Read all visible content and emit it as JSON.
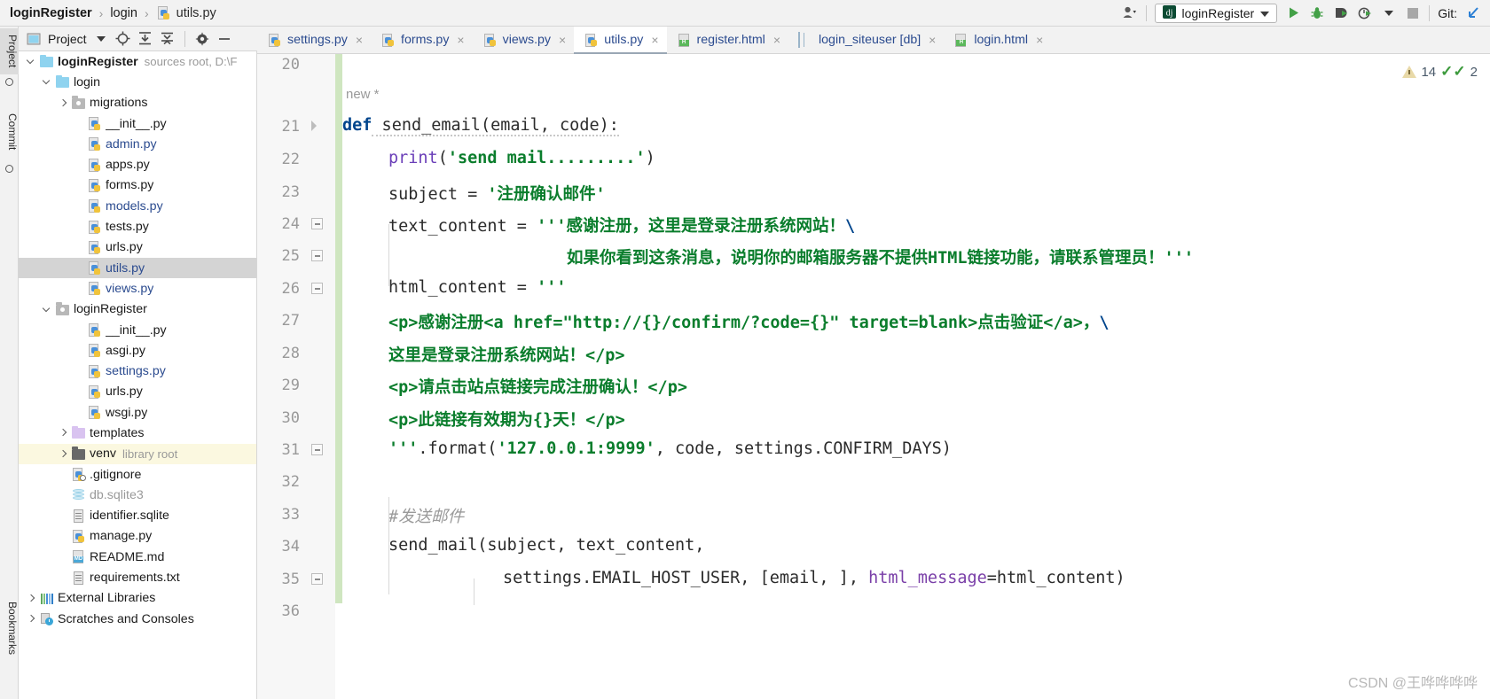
{
  "breadcrumb": {
    "items": [
      "loginRegister",
      "login",
      "utils.py"
    ],
    "separator": "›"
  },
  "topbar_right": {
    "account_icon": "user-account-icon",
    "run_config_name": "loginRegister",
    "run_config_icon": "django-icon",
    "dropdown_icon": "chevron-down-icon",
    "run_icon": "run-play-icon",
    "debug_icon": "debug-bug-icon",
    "coverage_icon": "run-coverage-icon",
    "profile_icon": "profiler-icon",
    "stop_icon": "stop-square-icon",
    "git_label": "Git:",
    "git_update_icon": "git-update-arrow-icon"
  },
  "left_strip": {
    "tabs": [
      "Project",
      "Commit",
      "Bookmarks"
    ]
  },
  "project_toolbar": {
    "title": "Project",
    "icons": [
      "project-view-icon",
      "chevron-down-icon",
      "locate-target-icon",
      "expand-all-icon",
      "collapse-all-icon",
      "settings-gear-icon",
      "hide-minus-icon"
    ]
  },
  "tree": {
    "items": [
      {
        "label": "loginRegister",
        "note": "sources root,  D:\\F",
        "icon": "folder-blue-icon",
        "indent": 0,
        "arrow": "open",
        "bold": true,
        "style": "plain"
      },
      {
        "label": "login",
        "note": "",
        "icon": "folder-blue-icon",
        "indent": 1,
        "arrow": "open",
        "bold": false,
        "style": "plain"
      },
      {
        "label": "migrations",
        "note": "",
        "icon": "folder-gray-icon",
        "indent": 2,
        "arrow": "closed",
        "bold": false,
        "style": "plain"
      },
      {
        "label": "__init__.py",
        "note": "",
        "icon": "python-file-icon",
        "indent": 3,
        "arrow": "none",
        "bold": false,
        "style": "plain"
      },
      {
        "label": "admin.py",
        "note": "",
        "icon": "python-file-icon",
        "indent": 3,
        "arrow": "none",
        "bold": false,
        "style": "blue"
      },
      {
        "label": "apps.py",
        "note": "",
        "icon": "python-file-icon",
        "indent": 3,
        "arrow": "none",
        "bold": false,
        "style": "plain"
      },
      {
        "label": "forms.py",
        "note": "",
        "icon": "python-file-icon",
        "indent": 3,
        "arrow": "none",
        "bold": false,
        "style": "plain"
      },
      {
        "label": "models.py",
        "note": "",
        "icon": "python-file-icon",
        "indent": 3,
        "arrow": "none",
        "bold": false,
        "style": "blue"
      },
      {
        "label": "tests.py",
        "note": "",
        "icon": "python-file-icon",
        "indent": 3,
        "arrow": "none",
        "bold": false,
        "style": "plain"
      },
      {
        "label": "urls.py",
        "note": "",
        "icon": "python-file-icon",
        "indent": 3,
        "arrow": "none",
        "bold": false,
        "style": "plain"
      },
      {
        "label": "utils.py",
        "note": "",
        "icon": "python-file-icon",
        "indent": 3,
        "arrow": "none",
        "bold": false,
        "style": "blue",
        "selected": true
      },
      {
        "label": "views.py",
        "note": "",
        "icon": "python-file-icon",
        "indent": 3,
        "arrow": "none",
        "bold": false,
        "style": "blue"
      },
      {
        "label": "loginRegister",
        "note": "",
        "icon": "folder-gray-icon",
        "indent": 1,
        "arrow": "open",
        "bold": false,
        "style": "plain"
      },
      {
        "label": "__init__.py",
        "note": "",
        "icon": "python-file-icon",
        "indent": 3,
        "arrow": "none",
        "bold": false,
        "style": "plain"
      },
      {
        "label": "asgi.py",
        "note": "",
        "icon": "python-file-icon",
        "indent": 3,
        "arrow": "none",
        "bold": false,
        "style": "plain"
      },
      {
        "label": "settings.py",
        "note": "",
        "icon": "python-file-icon",
        "indent": 3,
        "arrow": "none",
        "bold": false,
        "style": "blue"
      },
      {
        "label": "urls.py",
        "note": "",
        "icon": "python-file-icon",
        "indent": 3,
        "arrow": "none",
        "bold": false,
        "style": "plain"
      },
      {
        "label": "wsgi.py",
        "note": "",
        "icon": "python-file-icon",
        "indent": 3,
        "arrow": "none",
        "bold": false,
        "style": "plain"
      },
      {
        "label": "templates",
        "note": "",
        "icon": "folder-purple-icon",
        "indent": 2,
        "arrow": "closed",
        "bold": false,
        "style": "plain"
      },
      {
        "label": "venv",
        "note": "library root",
        "icon": "folder-dark-icon",
        "indent": 2,
        "arrow": "closed",
        "bold": false,
        "style": "plain",
        "highlight": true
      },
      {
        "label": ".gitignore",
        "note": "",
        "icon": "gitignore-file-icon",
        "indent": 2,
        "arrow": "none",
        "bold": false,
        "style": "plain"
      },
      {
        "label": "db.sqlite3",
        "note": "",
        "icon": "database-file-icon",
        "indent": 2,
        "arrow": "none",
        "bold": false,
        "style": "gray"
      },
      {
        "label": "identifier.sqlite",
        "note": "",
        "icon": "text-file-icon",
        "indent": 2,
        "arrow": "none",
        "bold": false,
        "style": "plain"
      },
      {
        "label": "manage.py",
        "note": "",
        "icon": "python-file-icon",
        "indent": 2,
        "arrow": "none",
        "bold": false,
        "style": "plain"
      },
      {
        "label": "README.md",
        "note": "",
        "icon": "markdown-file-icon",
        "indent": 2,
        "arrow": "none",
        "bold": false,
        "style": "plain"
      },
      {
        "label": "requirements.txt",
        "note": "",
        "icon": "text-file-icon",
        "indent": 2,
        "arrow": "none",
        "bold": false,
        "style": "plain"
      },
      {
        "label": "External Libraries",
        "note": "",
        "icon": "external-libraries-icon",
        "indent": 0,
        "arrow": "closed",
        "bold": false,
        "style": "plain"
      },
      {
        "label": "Scratches and Consoles",
        "note": "",
        "icon": "scratches-icon",
        "indent": 0,
        "arrow": "closed",
        "bold": false,
        "style": "plain"
      }
    ]
  },
  "editor_tabs": [
    {
      "label": "settings.py",
      "icon": "python-file-icon",
      "active": false,
      "close": "×"
    },
    {
      "label": "forms.py",
      "icon": "python-file-icon",
      "active": false,
      "close": "×"
    },
    {
      "label": "views.py",
      "icon": "python-file-icon",
      "active": false,
      "close": "×"
    },
    {
      "label": "utils.py",
      "icon": "python-file-icon",
      "active": true,
      "close": "×"
    },
    {
      "label": "register.html",
      "icon": "html-file-icon",
      "active": false,
      "close": "×"
    },
    {
      "label": "login_siteuser [db]",
      "icon": "database-table-icon",
      "active": false,
      "close": "×"
    },
    {
      "label": "login.html",
      "icon": "html-file-icon",
      "active": false,
      "close": "×"
    }
  ],
  "editor": {
    "new_marker": "new *",
    "line_numbers": [
      20,
      21,
      22,
      23,
      24,
      25,
      26,
      27,
      28,
      29,
      30,
      31,
      32,
      33,
      34,
      35,
      36
    ],
    "code_lines": [
      {
        "num": 20,
        "text": ""
      },
      {
        "num": 21,
        "text": "def send_email(email, code):"
      },
      {
        "num": 22,
        "text": "    print('send mail.........')"
      },
      {
        "num": 23,
        "text": "    subject = '注册确认邮件'"
      },
      {
        "num": 24,
        "text": "    text_content = '''感谢注册，这里是登录注册系统网站！\\"
      },
      {
        "num": 25,
        "text": "                    如果你看到这条消息，说明你的邮箱服务器不提供HTML链接功能，请联系管理员！'''"
      },
      {
        "num": 26,
        "text": "    html_content = '''"
      },
      {
        "num": 27,
        "text": "<p>感谢注册<a href=\"http://{}/confirm/?code={}\" target=blank>点击验证</a>，\\"
      },
      {
        "num": 28,
        "text": "这里是登录注册系统网站！</p>"
      },
      {
        "num": 29,
        "text": "<p>请点击站点链接完成注册确认！</p>"
      },
      {
        "num": 30,
        "text": "<p>此链接有效期为{}天！</p>"
      },
      {
        "num": 31,
        "text": "'''.format('127.0.0.1:9999', code, settings.CONFIRM_DAYS)"
      },
      {
        "num": 32,
        "text": ""
      },
      {
        "num": 33,
        "text": "    #发送邮件"
      },
      {
        "num": 34,
        "text": "    send_mail(subject, text_content,"
      },
      {
        "num": 35,
        "text": "              settings.EMAIL_HOST_USER, [email, ], html_message=html_content)"
      },
      {
        "num": 36,
        "text": ""
      }
    ],
    "tokens": {
      "l21_kw": "def",
      "l21_name": " send_email(email, code):",
      "l22_fn": "print",
      "l22_args": "(",
      "l22_str": "'send mail.........'",
      "l22_end": ")",
      "l23_var": "subject = ",
      "l23_str": "'注册确认邮件'",
      "l24_var": "text_content = ",
      "l24_str": "'''感谢注册，这里是登录注册系统网站！",
      "l24_esc": "\\",
      "l25_str": "如果你看到这条消息，说明你的邮箱服务器不提供HTML链接功能，请联系管理员！'''",
      "l26_var": "html_content = ",
      "l26_str": "'''",
      "l27_str": "<p>感谢注册<a href=\"http://{}/confirm/?code={}\" target=blank>点击验证</a>，",
      "l27_esc": "\\",
      "l28_str": "这里是登录注册系统网站！</p>",
      "l29_str": "<p>请点击站点链接完成注册确认！</p>",
      "l30_str": "<p>此链接有效期为{}天！</p>",
      "l31_q": "'''",
      "l31_fmt": ".format(",
      "l31_ip": "'127.0.0.1:9999'",
      "l31_rest": ", code, settings.CONFIRM_DAYS)",
      "l33_cmt": "#发送邮件",
      "l34_call": "send_mail(subject, text_content,",
      "l35_args": "settings.EMAIL_HOST_USER, [email, ], ",
      "l35_kwarg": "html_message",
      "l35_tail": "=html_content)"
    }
  },
  "inspection": {
    "warning_count": "14",
    "warning_icon": "warning-triangle-icon",
    "ok_count": "2",
    "ok_icon": "check-marks-icon"
  },
  "watermark": "CSDN @王哗哗哗哗",
  "colors": {
    "chrome_bg": "#f2f2f2",
    "editor_bg": "#ffffff",
    "selection": "#d4d4d4",
    "highlight_row": "#fbf8e0",
    "string_green": "#0a7d2c",
    "keyword_blue": "#00448c",
    "builtin_purple": "#6a3eb8",
    "link_blue": "#2b4b8f",
    "changebar_green": "#cfe6c0"
  }
}
